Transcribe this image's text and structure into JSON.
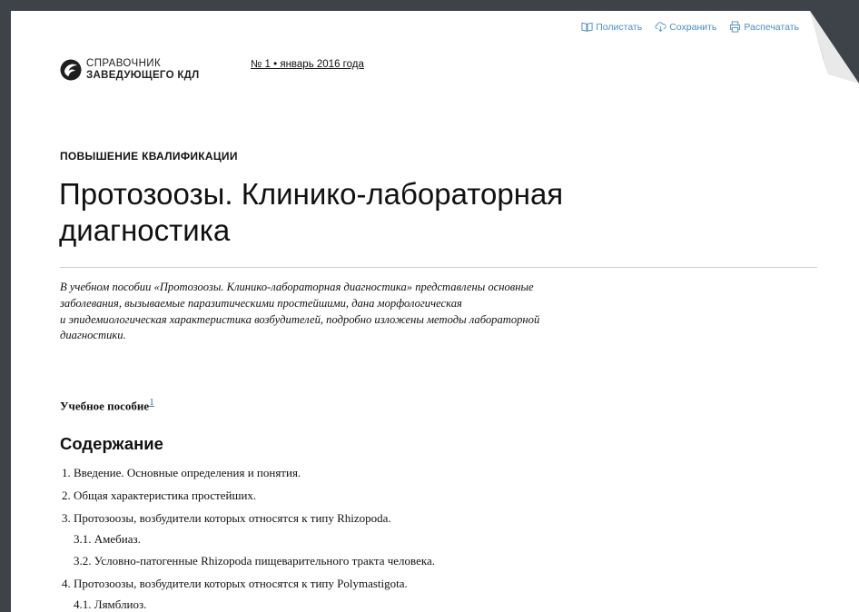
{
  "toolbar": {
    "browse_label": "Полистать",
    "save_label": "Сохранить",
    "print_label": "Распечатать"
  },
  "logo": {
    "line1": "СПРАВОЧНИК",
    "line2": "ЗАВЕДУЮЩЕГО КДЛ"
  },
  "issue": "№ 1 • январь 2016 года",
  "article": {
    "section": "ПОВЫШЕНИЕ КВАЛИФИКАЦИИ",
    "title_line1": "Протозоозы. Клинико-лабораторная",
    "title_line2": "диагностика",
    "lead_lines": [
      "В учебном пособии «Протозоозы. Клинико-лабораторная диагностика» представлены основные",
      "заболевания, вызываемые паразитическими простейшими, дана морфологическая",
      "и эпидемиологическая характеристика возбудителей, подробно изложены методы лабораторной",
      "диагностики."
    ],
    "tutorial_label": "Учебное пособие",
    "footnote": "1"
  },
  "toc": {
    "heading": "Содержание",
    "items": [
      "1. Введение. Основные определения и понятия.",
      "2. Общая характеристика простейших.",
      "3. Протозоозы, возбудители которых относятся к типу Rhizopoda.",
      "3.1. Амебиаз.",
      "3.2. Условно-патогенные Rhizopoda пищеварительного тракта человека.",
      "4. Протозоозы, возбудители которых относятся к типу Polymastigota.",
      "4.1. Лямблиоз."
    ]
  },
  "colors": {
    "background": "#3d4349",
    "page": "#ffffff",
    "link": "#4a8fc7"
  },
  "icons": [
    "book-icon",
    "cloud-download-icon",
    "printer-icon",
    "logo-icon"
  ]
}
